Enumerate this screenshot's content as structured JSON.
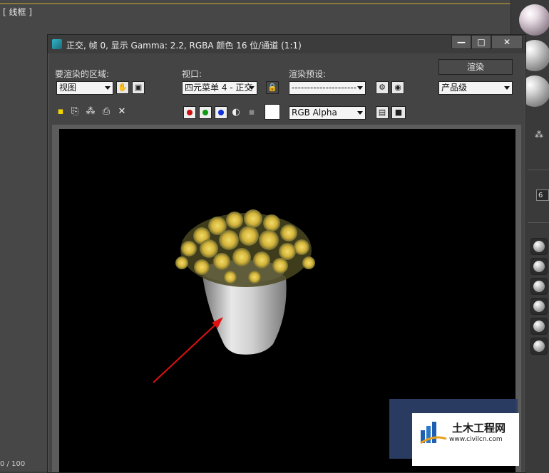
{
  "viewport": {
    "label": "[ 线框 ]",
    "frame_counter": "0 / 100"
  },
  "window": {
    "title": "正交, 帧 0, 显示 Gamma: 2.2, RGBA 颜色 16 位/通道 (1:1)",
    "min_label": "—",
    "max_label": "□",
    "close_label": "✕"
  },
  "toolbar": {
    "area_label": "要渲染的区域:",
    "area_value": "视图",
    "viewport_label": "视口:",
    "viewport_value": "四元菜单 4 - 正交",
    "preset_label": "渲染预设:",
    "preset_value": "---------------------",
    "render_button": "渲染",
    "quality_value": "产品级",
    "channel_value": "RGB Alpha"
  },
  "colors": {
    "red": "#d01010",
    "green": "#109a10",
    "blue": "#1030d8",
    "swatch": "#ffffff",
    "arrow": "#e01010"
  },
  "watermark": {
    "title": "土木工程网",
    "url": "www.civilcn.com"
  },
  "right_panel": {
    "field_value": "6"
  }
}
